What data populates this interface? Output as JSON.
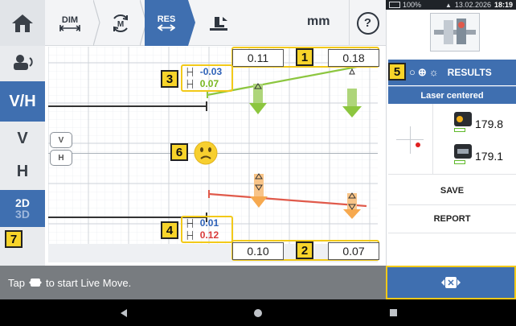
{
  "toolbar": {
    "dim_label": "DIM",
    "res_label": "RES",
    "units": "mm",
    "help_label": "?"
  },
  "left_rail": {
    "vh_label": "V/H",
    "v_label": "V",
    "h_label": "H",
    "twod_label": "2D",
    "threed_label": "3D"
  },
  "chart": {
    "top_left_value": "0.11",
    "top_right_value": "0.18",
    "bottom_left_value": "0.10",
    "bottom_right_value": "0.07",
    "vertical_angle_1": "-0.03",
    "vertical_angle_2": "0.07",
    "horizontal_angle_1": "0.01",
    "horizontal_angle_2": "0.12",
    "v_tag": "V",
    "h_tag": "H",
    "angle_colors": {
      "blue": "#2e62b8",
      "green": "#78b61f",
      "red": "#d93a3a"
    }
  },
  "callouts": {
    "c1": "1",
    "c2": "2",
    "c3": "3",
    "c4": "4",
    "c5": "5",
    "c6": "6",
    "c7": "7"
  },
  "status_bar": {
    "battery": "100%",
    "datetime": "13.02.2026",
    "time": "18:19"
  },
  "right_panel": {
    "results_label": "RESULTS",
    "status_text": "Laser centered",
    "sensor_value_1": "179.8",
    "sensor_value_2": "179.1",
    "save_label": "SAVE",
    "report_label": "REPORT"
  },
  "message": {
    "prefix": "Tap",
    "suffix": "to start Live Move."
  },
  "colors": {
    "accent": "#3f6fb0",
    "highlight": "#f2c919",
    "good": "#8cc63f",
    "bad": "#e05a4b",
    "arrow_orange": "#f6a94f"
  }
}
